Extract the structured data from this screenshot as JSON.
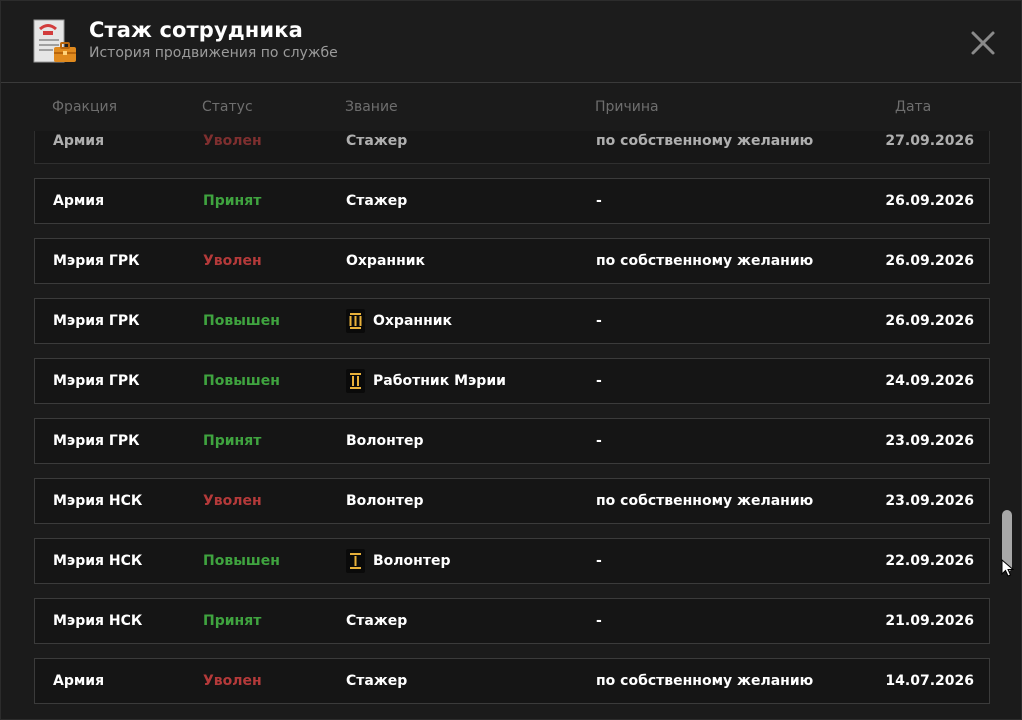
{
  "header": {
    "title": "Стаж сотрудника",
    "subtitle": "История продвижения по службе"
  },
  "columns": {
    "faction": "Фракция",
    "status": "Статус",
    "rank": "Звание",
    "reason": "Причина",
    "date": "Дата"
  },
  "colors": {
    "accepted": "#3fa33f",
    "promoted": "#3fa33f",
    "fired": "#b43a3a",
    "badge_gold": "#e8b13a"
  },
  "rows": [
    {
      "faction": "Армия",
      "status": "Уволен",
      "status_type": "fired",
      "rank": "Стажер",
      "badge": "",
      "reason": "по собственному желанию",
      "date": "27.09.2026"
    },
    {
      "faction": "Армия",
      "status": "Принят",
      "status_type": "accepted",
      "rank": "Стажер",
      "badge": "",
      "reason": "-",
      "date": "26.09.2026"
    },
    {
      "faction": "Мэрия ГРК",
      "status": "Уволен",
      "status_type": "fired",
      "rank": "Охранник",
      "badge": "",
      "reason": "по собственному желанию",
      "date": "26.09.2026"
    },
    {
      "faction": "Мэрия ГРК",
      "status": "Повышен",
      "status_type": "promoted",
      "rank": "Охранник",
      "badge": "rank-bars-3-icon",
      "reason": "-",
      "date": "26.09.2026"
    },
    {
      "faction": "Мэрия ГРК",
      "status": "Повышен",
      "status_type": "promoted",
      "rank": "Работник Мэрии",
      "badge": "rank-bars-2-icon",
      "reason": "-",
      "date": "24.09.2026"
    },
    {
      "faction": "Мэрия ГРК",
      "status": "Принят",
      "status_type": "accepted",
      "rank": "Волонтер",
      "badge": "",
      "reason": "-",
      "date": "23.09.2026"
    },
    {
      "faction": "Мэрия НСК",
      "status": "Уволен",
      "status_type": "fired",
      "rank": "Волонтер",
      "badge": "",
      "reason": "по собственному желанию",
      "date": "23.09.2026"
    },
    {
      "faction": "Мэрия НСК",
      "status": "Повышен",
      "status_type": "promoted",
      "rank": "Волонтер",
      "badge": "rank-bars-1-icon",
      "reason": "-",
      "date": "22.09.2026"
    },
    {
      "faction": "Мэрия НСК",
      "status": "Принят",
      "status_type": "accepted",
      "rank": "Стажер",
      "badge": "",
      "reason": "-",
      "date": "21.09.2026"
    },
    {
      "faction": "Армия",
      "status": "Уволен",
      "status_type": "fired",
      "rank": "Стажер",
      "badge": "",
      "reason": "по собственному желанию",
      "date": "14.07.2026"
    }
  ]
}
